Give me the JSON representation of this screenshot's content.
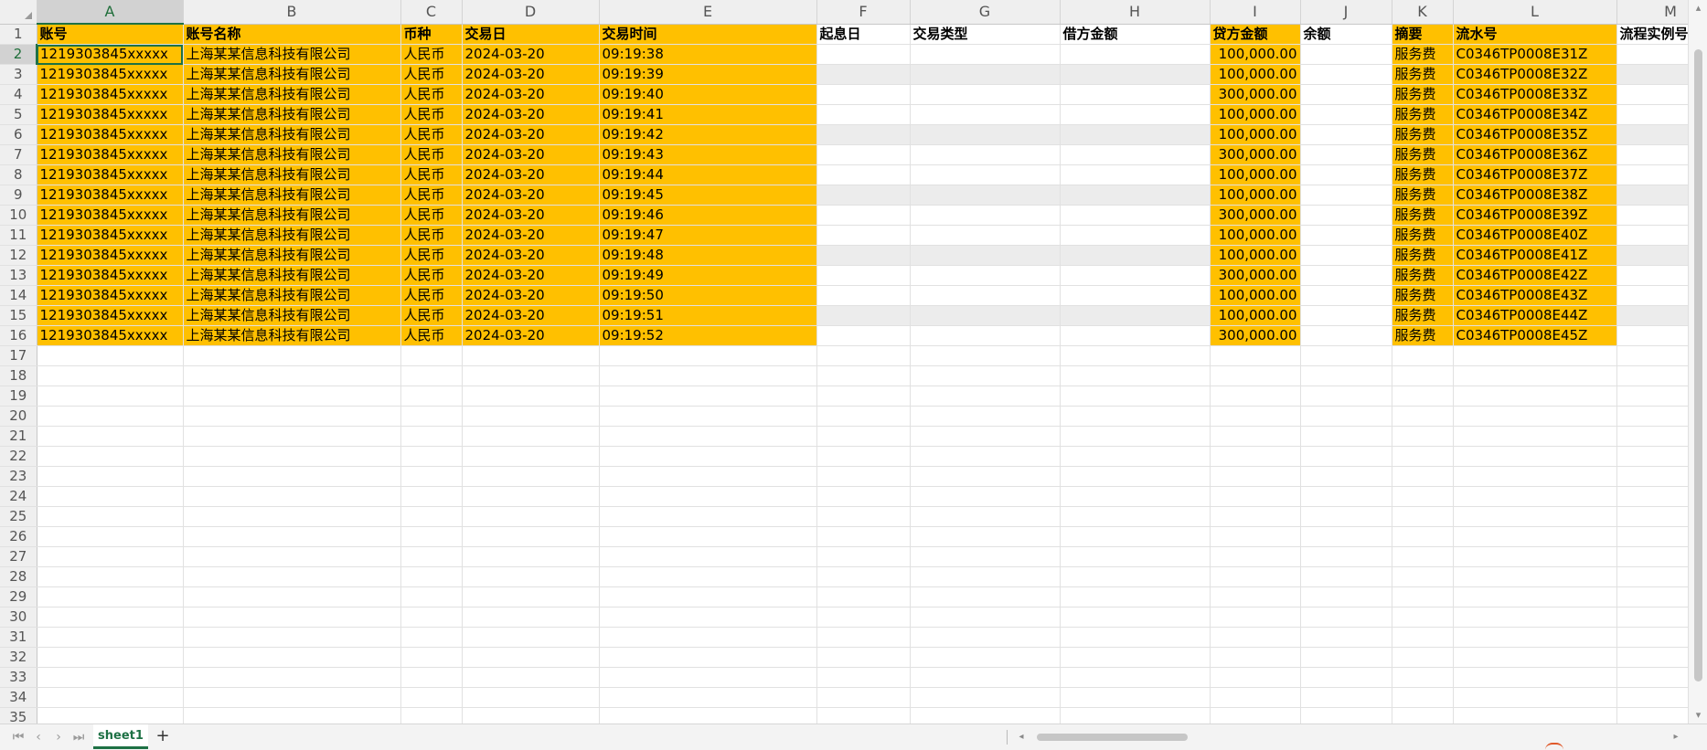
{
  "columns": [
    "A",
    "B",
    "C",
    "D",
    "E",
    "F",
    "G",
    "H",
    "I",
    "J",
    "K",
    "L",
    "M"
  ],
  "header": [
    "账号",
    "账号名称",
    "币种",
    "交易日",
    "交易时间",
    "起息日",
    "交易类型",
    "借方金额",
    "贷方金额",
    "余额",
    "摘要",
    "流水号",
    "流程实例号"
  ],
  "row_numbers": [
    "1",
    "2",
    "3",
    "4",
    "5",
    "6",
    "7",
    "8",
    "9",
    "10",
    "11",
    "12",
    "13",
    "14",
    "15",
    "16",
    "17",
    "18",
    "19",
    "20",
    "21",
    "22",
    "23",
    "24",
    "25",
    "26",
    "27",
    "28",
    "29",
    "30",
    "31",
    "32",
    "33",
    "34",
    "35"
  ],
  "rows": [
    {
      "account": "1219303845xxxxx",
      "name": "上海某某信息科技有限公司",
      "currency": "人民币",
      "date": "2024-03-20",
      "time": "09:19:38",
      "credit": "100,000.00",
      "summary": "服务费",
      "serial": "C0346TP0008E31Z"
    },
    {
      "account": "1219303845xxxxx",
      "name": "上海某某信息科技有限公司",
      "currency": "人民币",
      "date": "2024-03-20",
      "time": "09:19:39",
      "credit": "100,000.00",
      "summary": "服务费",
      "serial": "C0346TP0008E32Z"
    },
    {
      "account": "1219303845xxxxx",
      "name": "上海某某信息科技有限公司",
      "currency": "人民币",
      "date": "2024-03-20",
      "time": "09:19:40",
      "credit": "300,000.00",
      "summary": "服务费",
      "serial": "C0346TP0008E33Z"
    },
    {
      "account": "1219303845xxxxx",
      "name": "上海某某信息科技有限公司",
      "currency": "人民币",
      "date": "2024-03-20",
      "time": "09:19:41",
      "credit": "100,000.00",
      "summary": "服务费",
      "serial": "C0346TP0008E34Z"
    },
    {
      "account": "1219303845xxxxx",
      "name": "上海某某信息科技有限公司",
      "currency": "人民币",
      "date": "2024-03-20",
      "time": "09:19:42",
      "credit": "100,000.00",
      "summary": "服务费",
      "serial": "C0346TP0008E35Z"
    },
    {
      "account": "1219303845xxxxx",
      "name": "上海某某信息科技有限公司",
      "currency": "人民币",
      "date": "2024-03-20",
      "time": "09:19:43",
      "credit": "300,000.00",
      "summary": "服务费",
      "serial": "C0346TP0008E36Z"
    },
    {
      "account": "1219303845xxxxx",
      "name": "上海某某信息科技有限公司",
      "currency": "人民币",
      "date": "2024-03-20",
      "time": "09:19:44",
      "credit": "100,000.00",
      "summary": "服务费",
      "serial": "C0346TP0008E37Z"
    },
    {
      "account": "1219303845xxxxx",
      "name": "上海某某信息科技有限公司",
      "currency": "人民币",
      "date": "2024-03-20",
      "time": "09:19:45",
      "credit": "100,000.00",
      "summary": "服务费",
      "serial": "C0346TP0008E38Z"
    },
    {
      "account": "1219303845xxxxx",
      "name": "上海某某信息科技有限公司",
      "currency": "人民币",
      "date": "2024-03-20",
      "time": "09:19:46",
      "credit": "300,000.00",
      "summary": "服务费",
      "serial": "C0346TP0008E39Z"
    },
    {
      "account": "1219303845xxxxx",
      "name": "上海某某信息科技有限公司",
      "currency": "人民币",
      "date": "2024-03-20",
      "time": "09:19:47",
      "credit": "100,000.00",
      "summary": "服务费",
      "serial": "C0346TP0008E40Z"
    },
    {
      "account": "1219303845xxxxx",
      "name": "上海某某信息科技有限公司",
      "currency": "人民币",
      "date": "2024-03-20",
      "time": "09:19:48",
      "credit": "100,000.00",
      "summary": "服务费",
      "serial": "C0346TP0008E41Z"
    },
    {
      "account": "1219303845xxxxx",
      "name": "上海某某信息科技有限公司",
      "currency": "人民币",
      "date": "2024-03-20",
      "time": "09:19:49",
      "credit": "300,000.00",
      "summary": "服务费",
      "serial": "C0346TP0008E42Z"
    },
    {
      "account": "1219303845xxxxx",
      "name": "上海某某信息科技有限公司",
      "currency": "人民币",
      "date": "2024-03-20",
      "time": "09:19:50",
      "credit": "100,000.00",
      "summary": "服务费",
      "serial": "C0346TP0008E43Z"
    },
    {
      "account": "1219303845xxxxx",
      "name": "上海某某信息科技有限公司",
      "currency": "人民币",
      "date": "2024-03-20",
      "time": "09:19:51",
      "credit": "100,000.00",
      "summary": "服务费",
      "serial": "C0346TP0008E44Z"
    },
    {
      "account": "1219303845xxxxx",
      "name": "上海某某信息科技有限公司",
      "currency": "人民币",
      "date": "2024-03-20",
      "time": "09:19:52",
      "credit": "300,000.00",
      "summary": "服务费",
      "serial": "C0346TP0008E45Z"
    }
  ],
  "sheet_tabs": [
    "sheet1"
  ],
  "add_sheet_label": "+",
  "icons": {
    "select_all": "corner-triangle-icon",
    "first_sheet": "skip-first-icon",
    "prev_sheet": "chevron-left-icon",
    "next_sheet": "chevron-right-icon",
    "last_sheet": "skip-last-icon",
    "scroll_left": "caret-left-icon",
    "scroll_right": "caret-right-icon"
  },
  "colors": {
    "highlight": "#ffc000",
    "banded_gray": "#ececec",
    "accent_green": "#1e7145"
  }
}
